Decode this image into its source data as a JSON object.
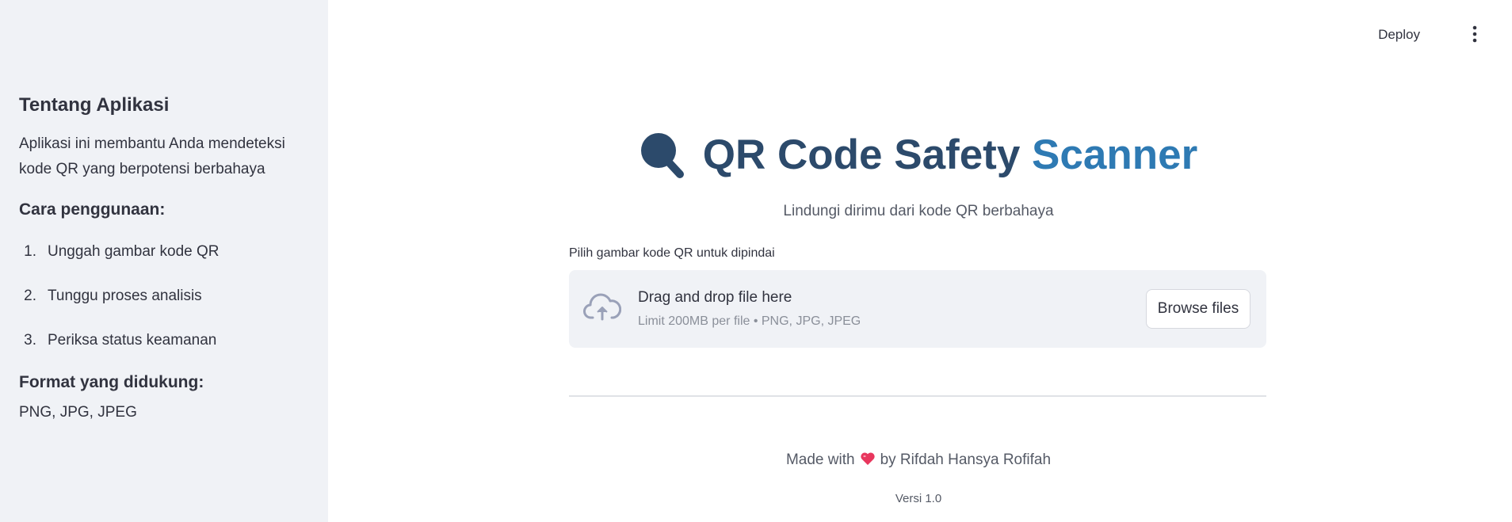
{
  "sidebar": {
    "about_heading": "Tentang Aplikasi",
    "about_text": "Aplikasi ini membantu Anda mendeteksi kode QR yang berpotensi berbahaya",
    "usage_heading": "Cara penggunaan:",
    "steps": [
      {
        "num": "1.",
        "label": "Unggah gambar kode QR"
      },
      {
        "num": "2.",
        "label": "Tunggu proses analisis"
      },
      {
        "num": "3.",
        "label": "Periksa status keamanan"
      }
    ],
    "formats_heading": "Format yang didukung:",
    "formats_text": "PNG, JPG, JPEG"
  },
  "header": {
    "deploy_label": "Deploy",
    "menu_icon": "vertical-ellipsis-icon"
  },
  "main": {
    "title_icon": "magnifier-icon",
    "title_part1": "QR Code Safety",
    "title_part2": "Scanner",
    "subtitle": "Lindungi dirimu dari kode QR berbahaya",
    "uploader": {
      "label": "Pilih gambar kode QR untuk dipindai",
      "icon": "cloud-upload-icon",
      "drop_title": "Drag and drop file here",
      "drop_limit": "Limit 200MB per file • PNG, JPG, JPEG",
      "browse_label": "Browse files"
    },
    "footer": {
      "made_with": "Made with",
      "heart_icon": "heart-icon",
      "by": "by Rifdah Hansya Rofifah",
      "version": "Versi 1.0"
    }
  },
  "colors": {
    "sidebar_bg": "#f0f2f6",
    "title_dark": "#2c4a6b",
    "title_light": "#2e7ab3",
    "heart": "#e8365d"
  }
}
